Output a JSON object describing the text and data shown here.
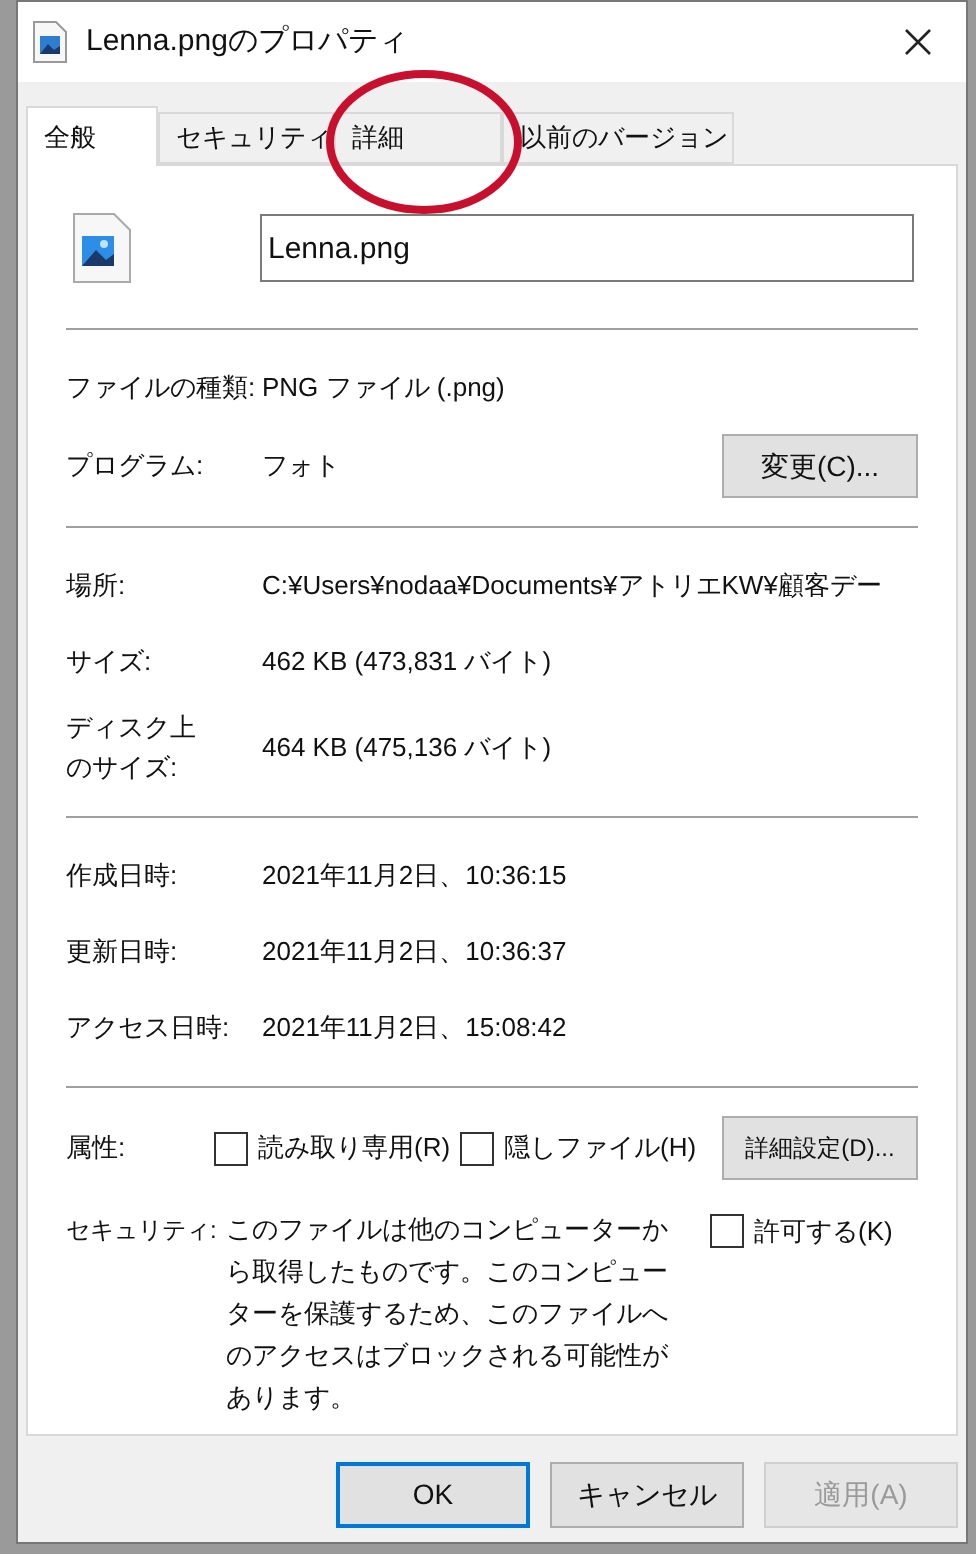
{
  "window": {
    "title": "Lenna.pngのプロパティ"
  },
  "tabs": [
    {
      "label": "全般",
      "selected": true
    },
    {
      "label": "セキュリティ",
      "selected": false
    },
    {
      "label": "詳細",
      "selected": false
    },
    {
      "label": "以前のバージョン",
      "selected": false
    }
  ],
  "file_name": {
    "value": "Lenna.png"
  },
  "sections": [
    {
      "rows": [
        {
          "label": "ファイルの種類:",
          "value": "PNG ファイル (.png)"
        },
        {
          "label": "プログラム:",
          "value": "フォト",
          "button": "変更(C)..."
        }
      ]
    },
    {
      "rows": [
        {
          "label": "場所:",
          "value": "C:¥Users¥nodaa¥Documents¥アトリエKW¥顧客デー"
        },
        {
          "label": "サイズ:",
          "value": "462 KB (473,831 バイト)"
        },
        {
          "label": "ディスク上のサイズ:",
          "value": "464 KB (475,136 バイト)"
        }
      ]
    },
    {
      "rows": [
        {
          "label": "作成日時:",
          "value": "2021年11月2日、10:36:15"
        },
        {
          "label": "更新日時:",
          "value": "2021年11月2日、10:36:37"
        },
        {
          "label": "アクセス日時:",
          "value": "2021年11月2日、15:08:42"
        }
      ]
    }
  ],
  "attributes": {
    "label": "属性:",
    "checkboxes": [
      {
        "label": "読み取り専用(R)",
        "checked": false
      },
      {
        "label": "隠しファイル(H)",
        "checked": false
      }
    ],
    "button": "詳細設定(D)..."
  },
  "security": {
    "label": "セキュリティ:",
    "text": "このファイルは他のコンピューターから取得したものです。このコンピューターを保護するため、このファイルへのアクセスはブロックされる可能性があります。",
    "checkbox": {
      "label": "許可する(K)",
      "checked": false
    }
  },
  "buttons": [
    {
      "label": "OK",
      "default": true,
      "disabled": false
    },
    {
      "label": "キャンセル",
      "default": false,
      "disabled": false
    },
    {
      "label": "適用(A)",
      "default": false,
      "disabled": true
    }
  ],
  "markup": [
    {
      "kind": "ellipse",
      "color": "#c8102e"
    }
  ]
}
